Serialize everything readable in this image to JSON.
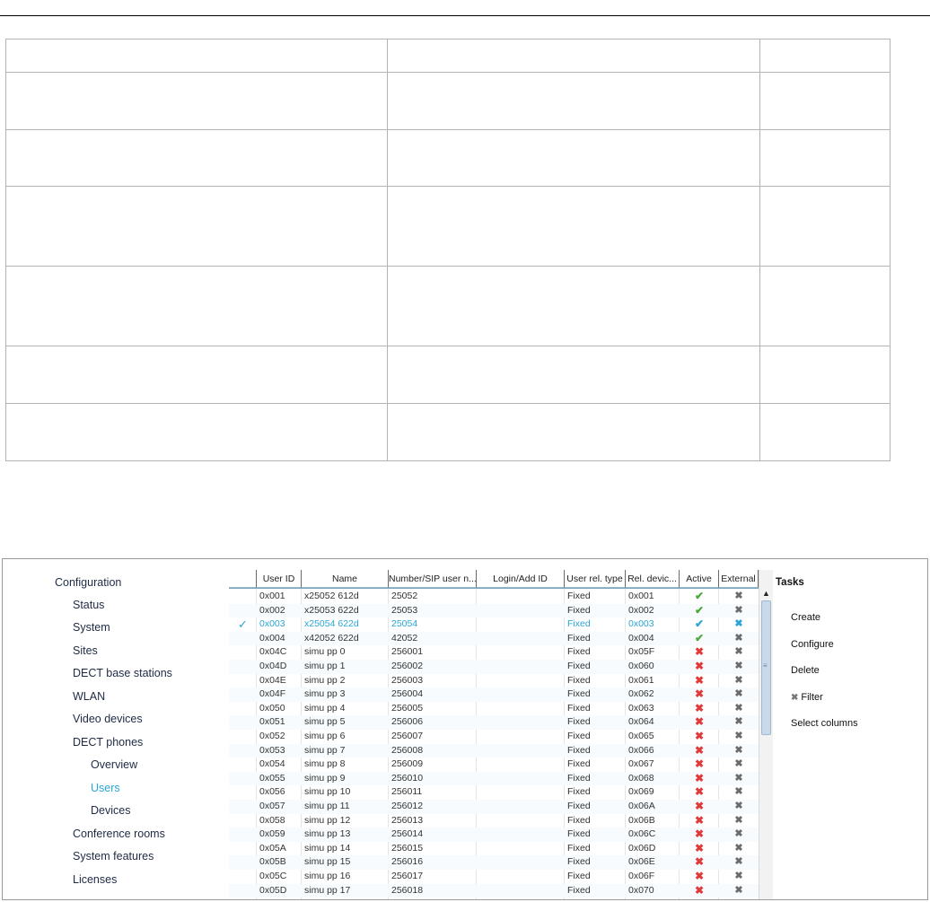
{
  "nav": {
    "root": "Configuration",
    "items": [
      {
        "label": "Status"
      },
      {
        "label": "System"
      },
      {
        "label": "Sites"
      },
      {
        "label": "DECT base stations"
      },
      {
        "label": "WLAN"
      },
      {
        "label": "Video devices"
      },
      {
        "label": "DECT phones"
      },
      {
        "label": "Overview"
      },
      {
        "label": "Users"
      },
      {
        "label": "Devices"
      },
      {
        "label": "Conference rooms"
      },
      {
        "label": "System features"
      },
      {
        "label": "Licenses"
      }
    ]
  },
  "grid": {
    "columns": [
      "",
      "User ID",
      "Name",
      "Number/SIP user n...",
      "Login/Add ID",
      "User rel. type",
      "Rel. devic...",
      "Active",
      "External"
    ],
    "rows": [
      {
        "id": "0x001",
        "name": "x25052  612d",
        "number": "25052",
        "type": "Fixed",
        "dev": "0x001",
        "active": true
      },
      {
        "id": "0x002",
        "name": "x25053  622d",
        "number": "25053",
        "type": "Fixed",
        "dev": "0x002",
        "active": true
      },
      {
        "id": "0x003",
        "name": "x25054  622d",
        "number": "25054",
        "type": "Fixed",
        "dev": "0x003",
        "active": true,
        "selected": true
      },
      {
        "id": "0x004",
        "name": "x42052  622d",
        "number": "42052",
        "type": "Fixed",
        "dev": "0x004",
        "active": true
      },
      {
        "id": "0x04C",
        "name": "simu pp 0",
        "number": "256001",
        "type": "Fixed",
        "dev": "0x05F",
        "active": false
      },
      {
        "id": "0x04D",
        "name": "simu pp 1",
        "number": "256002",
        "type": "Fixed",
        "dev": "0x060",
        "active": false
      },
      {
        "id": "0x04E",
        "name": "simu pp 2",
        "number": "256003",
        "type": "Fixed",
        "dev": "0x061",
        "active": false
      },
      {
        "id": "0x04F",
        "name": "simu pp 3",
        "number": "256004",
        "type": "Fixed",
        "dev": "0x062",
        "active": false
      },
      {
        "id": "0x050",
        "name": "simu pp 4",
        "number": "256005",
        "type": "Fixed",
        "dev": "0x063",
        "active": false
      },
      {
        "id": "0x051",
        "name": "simu pp 5",
        "number": "256006",
        "type": "Fixed",
        "dev": "0x064",
        "active": false
      },
      {
        "id": "0x052",
        "name": "simu pp 6",
        "number": "256007",
        "type": "Fixed",
        "dev": "0x065",
        "active": false
      },
      {
        "id": "0x053",
        "name": "simu pp 7",
        "number": "256008",
        "type": "Fixed",
        "dev": "0x066",
        "active": false
      },
      {
        "id": "0x054",
        "name": "simu pp 8",
        "number": "256009",
        "type": "Fixed",
        "dev": "0x067",
        "active": false
      },
      {
        "id": "0x055",
        "name": "simu pp 9",
        "number": "256010",
        "type": "Fixed",
        "dev": "0x068",
        "active": false
      },
      {
        "id": "0x056",
        "name": "simu pp 10",
        "number": "256011",
        "type": "Fixed",
        "dev": "0x069",
        "active": false
      },
      {
        "id": "0x057",
        "name": "simu pp 11",
        "number": "256012",
        "type": "Fixed",
        "dev": "0x06A",
        "active": false
      },
      {
        "id": "0x058",
        "name": "simu pp 12",
        "number": "256013",
        "type": "Fixed",
        "dev": "0x06B",
        "active": false
      },
      {
        "id": "0x059",
        "name": "simu pp 13",
        "number": "256014",
        "type": "Fixed",
        "dev": "0x06C",
        "active": false
      },
      {
        "id": "0x05A",
        "name": "simu pp 14",
        "number": "256015",
        "type": "Fixed",
        "dev": "0x06D",
        "active": false
      },
      {
        "id": "0x05B",
        "name": "simu pp 15",
        "number": "256016",
        "type": "Fixed",
        "dev": "0x06E",
        "active": false
      },
      {
        "id": "0x05C",
        "name": "simu pp 16",
        "number": "256017",
        "type": "Fixed",
        "dev": "0x06F",
        "active": false
      },
      {
        "id": "0x05D",
        "name": "simu pp 17",
        "number": "256018",
        "type": "Fixed",
        "dev": "0x070",
        "active": false
      }
    ]
  },
  "tasks": {
    "title": "Tasks",
    "items": [
      "Create",
      "Configure",
      "Delete",
      "Filter",
      "Select columns"
    ]
  },
  "icons": {
    "selected_check": "✓",
    "active_yes": "✔",
    "active_no": "✖",
    "external_no": "✖",
    "scroll_up": "▲",
    "filter_icon": "✖",
    "grip": "≡"
  },
  "colors": {
    "accent": "#29a6d6",
    "active_yes": "#4aa83b",
    "active_no": "#e03a3a"
  }
}
